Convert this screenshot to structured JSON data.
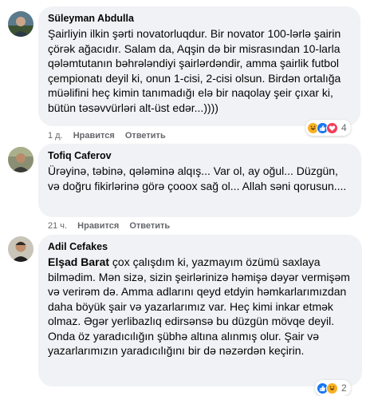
{
  "comments": [
    {
      "author": "Süleyman Abdulla",
      "text": "Şairliyin ilkin şərti novatorluqdur. Bir novator 100-lərlə şairin çörək ağacıdır. Salam da, Aqşin də bir misrasından 10-larla qələmtutanın bəhrələndiyi şairlərdəndir, amma şairlik futbol çempionatı deyil ki, onun 1-cisi, 2-cisi olsun. Birdən ortalığa müəlifini heç kimin tanımadığı elə bir naqolay şeir çıxar ki, bütün təsəvvürləri alt-üst edər...))))",
      "time": "1 д.",
      "like_label": "Нравится",
      "reply_label": "Ответить",
      "reaction_count": "4",
      "reaction_icons": [
        "haha",
        "like",
        "love"
      ]
    },
    {
      "author": "Tofiq Caferov",
      "text": "Ürəyinə, təbinə, qələminə alqış... Var ol, ay oğul... Düzgün, və doğru fikirlərinə görə çooox sağ ol... Allah səni qorusun....",
      "time": "21 ч.",
      "like_label": "Нравится",
      "reply_label": "Ответить"
    },
    {
      "author": "Adil Cefakes",
      "mention": "Elşad Barat",
      "text": " çox çalışdım ki, yazmayım özümü saxlaya bilmədim. Mən sizə, sizin şeirlərinizə həmişə dəyər vermişəm və verirəm də. Amma adlarını qeyd etdyin həmkarlarımızdan daha böyük şair və yazarlarımız var. Heç kimi inkar etmək olmaz. Əgər yerlibazlıq edirsənsə bu düzgün mövqe deyil. Onda öz yaradıcılığın şübhə altına alınmış olur. Şair və yazarlarımızın yaradıcılığını bir də nəzərdən keçirin.",
      "reaction_count": "2",
      "reaction_icons": [
        "like",
        "haha"
      ]
    }
  ],
  "colors": {
    "bubble": "#f0f2f5",
    "meta": "#65676b",
    "like": "#1877f2",
    "love": "#f33e58",
    "haha": "#f7b125"
  }
}
